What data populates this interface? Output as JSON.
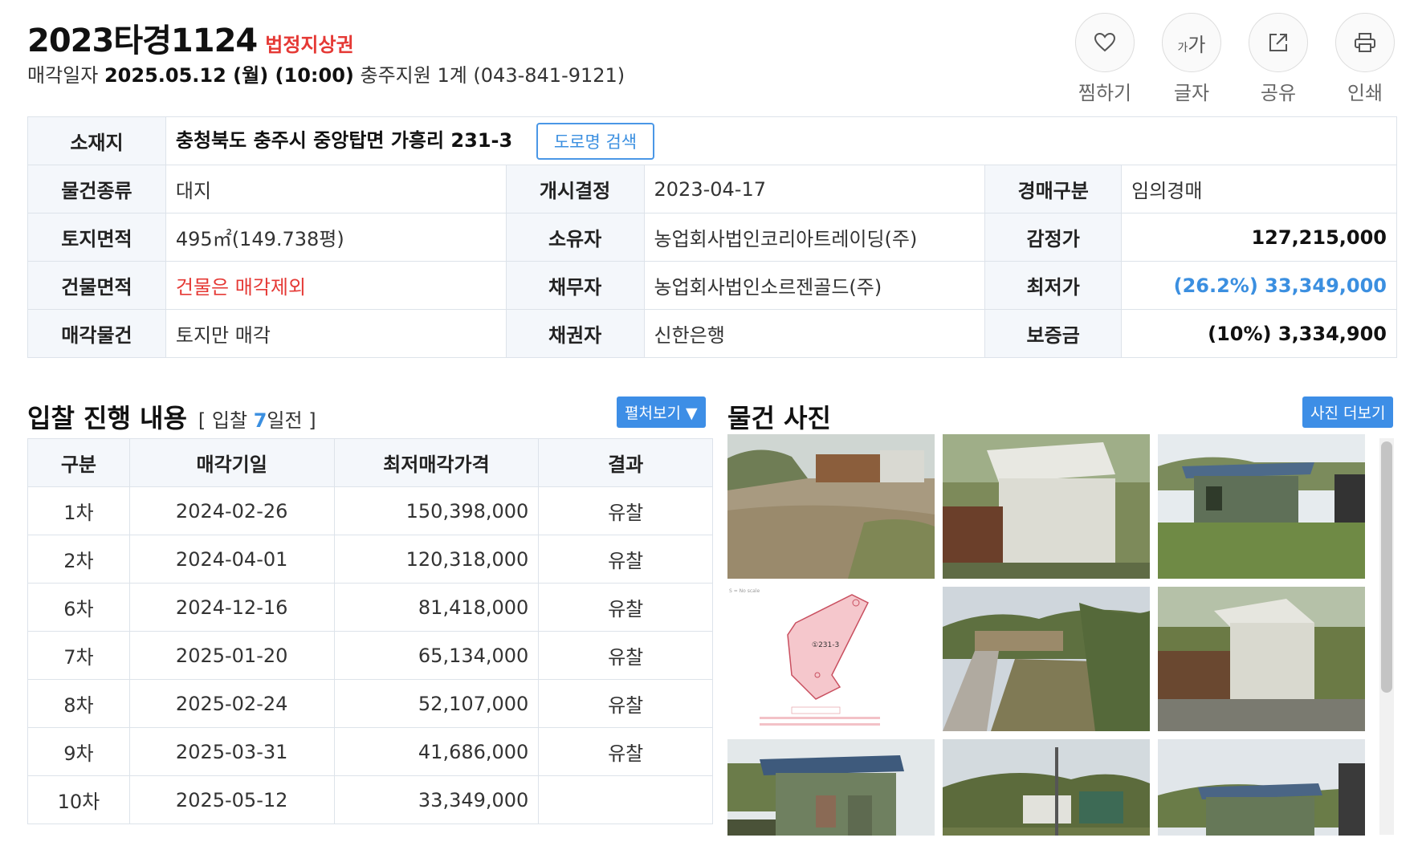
{
  "header": {
    "case_no": "2023타경1124",
    "tag": "법정지상권",
    "sale_prefix": "매각일자",
    "sale_date": "2025.05.12 (월) (10:00)",
    "court": "충주지원 1계 (043-841-9121)"
  },
  "actions": [
    {
      "label": "찜하기",
      "icon": "heart-icon"
    },
    {
      "label": "글자",
      "icon": "font-size-icon",
      "glyph_small": "가",
      "glyph_big": "가"
    },
    {
      "label": "공유",
      "icon": "share-icon"
    },
    {
      "label": "인쇄",
      "icon": "print-icon"
    }
  ],
  "info": {
    "address_label": "소재지",
    "address": "충청북도 충주시 중앙탑면 가흥리 231-3",
    "road_search": "도로명 검색",
    "rows": [
      [
        {
          "label": "물건종류",
          "value": "대지"
        },
        {
          "label": "개시결정",
          "value": "2023-04-17"
        },
        {
          "label": "경매구분",
          "value": "임의경매"
        }
      ],
      [
        {
          "label": "토지면적",
          "value": "495㎡(149.738평)"
        },
        {
          "label": "소유자",
          "value": "농업회사법인코리아트레이딩(주)"
        },
        {
          "label": "감정가",
          "value": "127,215,000"
        }
      ],
      [
        {
          "label": "건물면적",
          "value": "건물은 매각제외"
        },
        {
          "label": "채무자",
          "value": "농업회사법인소르젠골드(주)"
        },
        {
          "label": "최저가",
          "value": "(26.2%) 33,349,000"
        }
      ],
      [
        {
          "label": "매각물건",
          "value": "토지만 매각"
        },
        {
          "label": "채권자",
          "value": "신한은행"
        },
        {
          "label": "보증금",
          "value": "(10%) 3,334,900"
        }
      ]
    ]
  },
  "bid": {
    "title": "입찰 진행 내용",
    "count_prefix": "[ 입찰 ",
    "count_num": "7",
    "count_suffix": "일전 ]",
    "toggle": "펼처보기 ▼",
    "headers": [
      "구분",
      "매각기일",
      "최저매각가격",
      "결과"
    ],
    "rows": [
      [
        "1차",
        "2024-02-26",
        "150,398,000",
        "유찰"
      ],
      [
        "2차",
        "2024-04-01",
        "120,318,000",
        "유찰"
      ],
      [
        "6차",
        "2024-12-16",
        "81,418,000",
        "유찰"
      ],
      [
        "7차",
        "2025-01-20",
        "65,134,000",
        "유찰"
      ],
      [
        "8차",
        "2025-02-24",
        "52,107,000",
        "유찰"
      ],
      [
        "9차",
        "2025-03-31",
        "41,686,000",
        "유찰"
      ],
      [
        "10차",
        "2025-05-12",
        "33,349,000",
        ""
      ]
    ]
  },
  "photos": {
    "title": "물건 사진",
    "more": "사진 더보기",
    "map_parcel_label": "①231-3",
    "map_scale_note": "S = No scale"
  },
  "colors": {
    "accent_blue": "#3b8fe0",
    "alert_red": "#e53935",
    "header_bg": "#f4f7fb",
    "border": "#dde3ea"
  }
}
